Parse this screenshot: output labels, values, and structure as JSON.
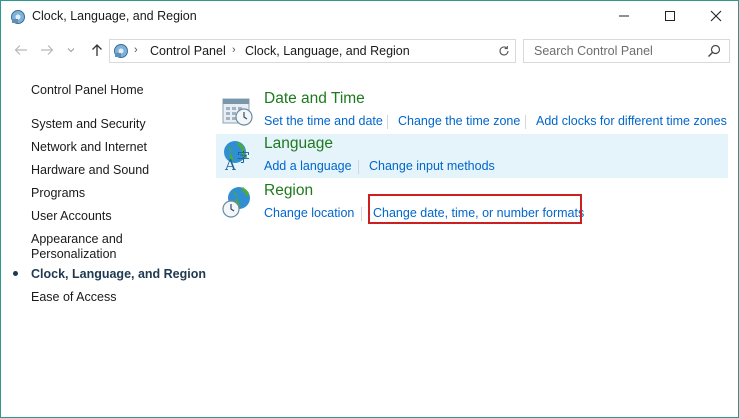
{
  "window": {
    "title": "Clock, Language, and Region",
    "controls": [
      "minimize-icon",
      "maximize-icon",
      "close-icon"
    ]
  },
  "address": {
    "crumbs": [
      "Control Panel",
      "Clock, Language, and Region"
    ],
    "search_placeholder": "Search Control Panel"
  },
  "sidebar": {
    "items": [
      {
        "label": "Control Panel Home"
      },
      {
        "label": "System and Security"
      },
      {
        "label": "Network and Internet"
      },
      {
        "label": "Hardware and Sound"
      },
      {
        "label": "Programs"
      },
      {
        "label": "User Accounts"
      },
      {
        "label": "Appearance and"
      },
      {
        "label": "Personalization"
      },
      {
        "label": "Clock, Language, and Region",
        "active": true
      },
      {
        "label": "Ease of Access"
      }
    ]
  },
  "categories": [
    {
      "title": "Date and Time",
      "icon": "calendar-clock-icon",
      "links": [
        "Set the time and date",
        "Change the time zone",
        "Add clocks for different time zones"
      ]
    },
    {
      "title": "Language",
      "icon": "language-globe-icon",
      "links": [
        "Add a language",
        "Change input methods"
      ]
    },
    {
      "title": "Region",
      "icon": "region-globe-clock-icon",
      "links": [
        "Change location",
        "Change date, time, or number formats"
      ]
    }
  ],
  "colors": {
    "link": "#0066cc",
    "category_title": "#1e7a1e",
    "highlight_bg": "#e5f3fb",
    "annotation_box": "#cc1f1f",
    "window_border": "#2b9a8c"
  }
}
